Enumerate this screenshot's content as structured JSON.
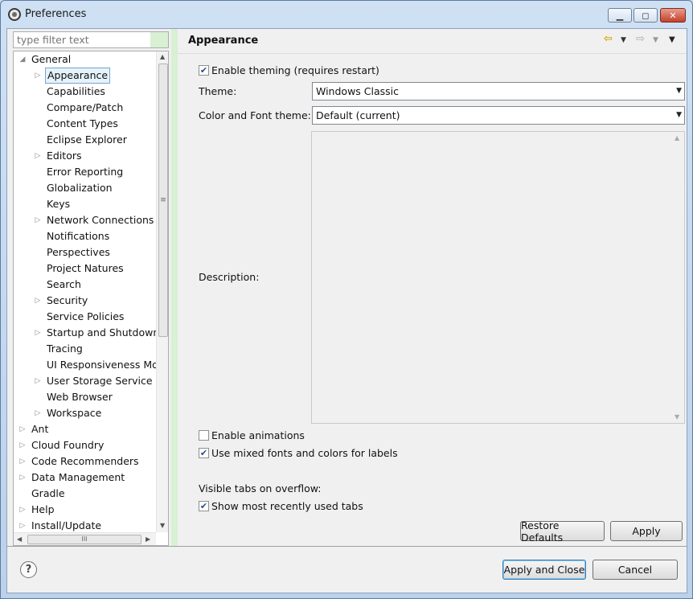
{
  "window": {
    "title": "Preferences",
    "minimize_glyph": "▁",
    "maximize_glyph": "◻",
    "close_glyph": "✕"
  },
  "sidebar": {
    "filter_placeholder": "type filter text",
    "tree": [
      {
        "label": "General",
        "level": 0,
        "arrow": "◢"
      },
      {
        "label": "Appearance",
        "level": 1,
        "arrow": "▷",
        "selected": true
      },
      {
        "label": "Capabilities",
        "level": 1,
        "arrow": ""
      },
      {
        "label": "Compare/Patch",
        "level": 1,
        "arrow": ""
      },
      {
        "label": "Content Types",
        "level": 1,
        "arrow": ""
      },
      {
        "label": "Eclipse Explorer",
        "level": 1,
        "arrow": ""
      },
      {
        "label": "Editors",
        "level": 1,
        "arrow": "▷"
      },
      {
        "label": "Error Reporting",
        "level": 1,
        "arrow": ""
      },
      {
        "label": "Globalization",
        "level": 1,
        "arrow": ""
      },
      {
        "label": "Keys",
        "level": 1,
        "arrow": ""
      },
      {
        "label": "Network Connections",
        "level": 1,
        "arrow": "▷"
      },
      {
        "label": "Notifications",
        "level": 1,
        "arrow": ""
      },
      {
        "label": "Perspectives",
        "level": 1,
        "arrow": ""
      },
      {
        "label": "Project Natures",
        "level": 1,
        "arrow": ""
      },
      {
        "label": "Search",
        "level": 1,
        "arrow": ""
      },
      {
        "label": "Security",
        "level": 1,
        "arrow": "▷"
      },
      {
        "label": "Service Policies",
        "level": 1,
        "arrow": ""
      },
      {
        "label": "Startup and Shutdown",
        "level": 1,
        "arrow": "▷"
      },
      {
        "label": "Tracing",
        "level": 1,
        "arrow": ""
      },
      {
        "label": "UI Responsiveness Mo",
        "level": 1,
        "arrow": ""
      },
      {
        "label": "User Storage Service",
        "level": 1,
        "arrow": "▷"
      },
      {
        "label": "Web Browser",
        "level": 1,
        "arrow": ""
      },
      {
        "label": "Workspace",
        "level": 1,
        "arrow": "▷"
      },
      {
        "label": "Ant",
        "level": 0,
        "arrow": "▷"
      },
      {
        "label": "Cloud Foundry",
        "level": 0,
        "arrow": "▷"
      },
      {
        "label": "Code Recommenders",
        "level": 0,
        "arrow": "▷"
      },
      {
        "label": "Data Management",
        "level": 0,
        "arrow": "▷"
      },
      {
        "label": "Gradle",
        "level": 0,
        "arrow": ""
      },
      {
        "label": "Help",
        "level": 0,
        "arrow": "▷"
      },
      {
        "label": "Install/Update",
        "level": 0,
        "arrow": "▷"
      }
    ],
    "scroll_up_glyph": "▲",
    "scroll_down_glyph": "▼",
    "scroll_thumb_glyph": "≡",
    "scroll_left_glyph": "◀",
    "scroll_right_glyph": "▶",
    "hscroll_thumb_glyph": "III"
  },
  "main": {
    "page_title": "Appearance",
    "nav": {
      "back": "⇦",
      "back_menu": "▼",
      "forward": "⇨",
      "forward_menu": "▼",
      "view_menu": "▼"
    },
    "enable_theming": {
      "label": "Enable theming (requires restart)",
      "checked": true
    },
    "theme": {
      "label": "Theme:",
      "value": "Windows Classic"
    },
    "color_font_theme": {
      "label": "Color and Font theme:",
      "value": "Default (current)"
    },
    "description_label": "Description:",
    "enable_animations": {
      "label": "Enable animations",
      "checked": false
    },
    "mixed_fonts": {
      "label": "Use mixed fonts and colors for labels",
      "checked": true
    },
    "visible_tabs_label": "Visible tabs on overflow:",
    "show_mru_tabs": {
      "label": "Show most recently used tabs",
      "checked": true
    },
    "restore_defaults": "Restore Defaults",
    "apply": "Apply"
  },
  "footer": {
    "help_glyph": "?",
    "apply_and_close": "Apply and Close",
    "cancel": "Cancel"
  },
  "icons": {
    "app": "eclipse-icon",
    "check": "✔",
    "combo_arrow": "▼"
  }
}
